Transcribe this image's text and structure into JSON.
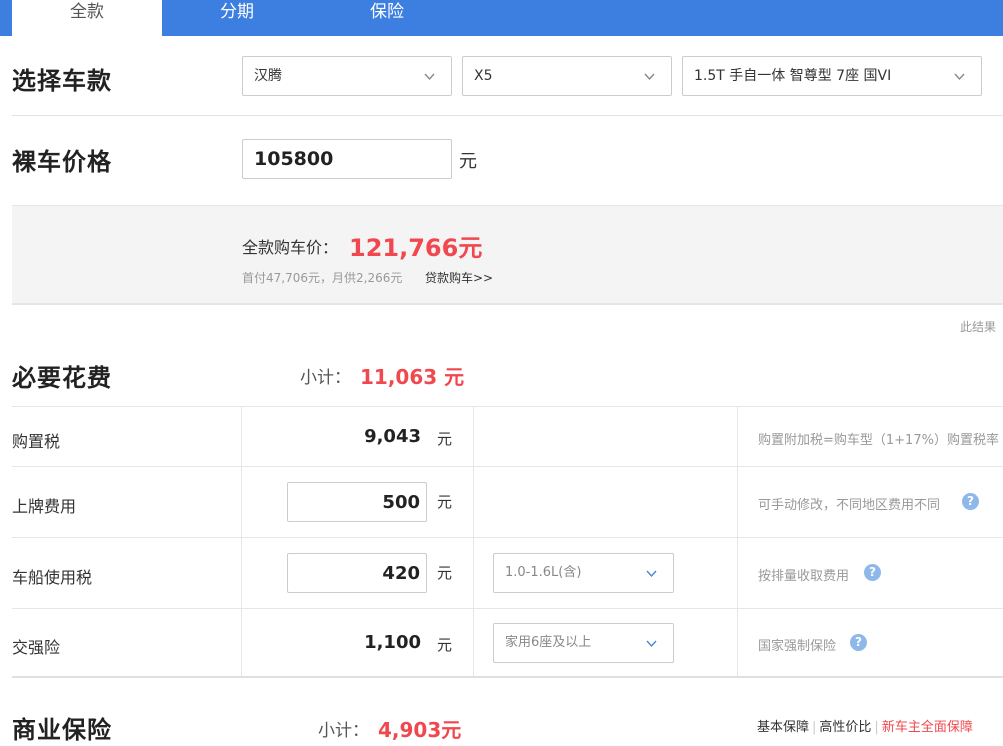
{
  "tabs": [
    {
      "label": "全款",
      "active": true
    },
    {
      "label": "分期",
      "active": false
    },
    {
      "label": "保险",
      "active": false
    }
  ],
  "select_car": {
    "title": "选择车款",
    "brand": "汉腾",
    "model": "X5",
    "trim": "1.5T 手自一体 智尊型 7座 国VI"
  },
  "bare_price": {
    "title": "裸车价格",
    "value": "105800",
    "unit": "元"
  },
  "summary": {
    "label": "全款购车价：",
    "value": "121,766元",
    "sub": "首付47,706元，月供2,266元",
    "loan_link": "贷款购车>>"
  },
  "note_right": "此结果",
  "required": {
    "title": "必要花费",
    "subtotal_label": "小计：",
    "subtotal_value": "11,063 元",
    "rows": [
      {
        "label": "购置税",
        "value": "9,043",
        "unit": "元",
        "note": "购置附加税=购车型（1+17%）购置税率"
      },
      {
        "label": "上牌费用",
        "value": "500",
        "unit": "元",
        "note": "可手动修改，不同地区费用不同"
      },
      {
        "label": "车船使用税",
        "value": "420",
        "unit": "元",
        "option": "1.0-1.6L(含)",
        "note": "按排量收取费用"
      },
      {
        "label": "交强险",
        "value": "1,100",
        "unit": "元",
        "option": "家用6座及以上",
        "note": "国家强制保险"
      }
    ]
  },
  "commercial": {
    "title": "商业保险",
    "subtotal_label": "小计：",
    "subtotal_value": "4,903元",
    "links": [
      "基本保障",
      "高性价比",
      "新车主全面保障"
    ]
  },
  "icons": {
    "chevron": "chevron-down-icon",
    "help": "question-icon"
  },
  "colors": {
    "tab_bar": "#3d7fe0",
    "price_red": "#f0484e",
    "help_blue": "#8fb8ea"
  }
}
